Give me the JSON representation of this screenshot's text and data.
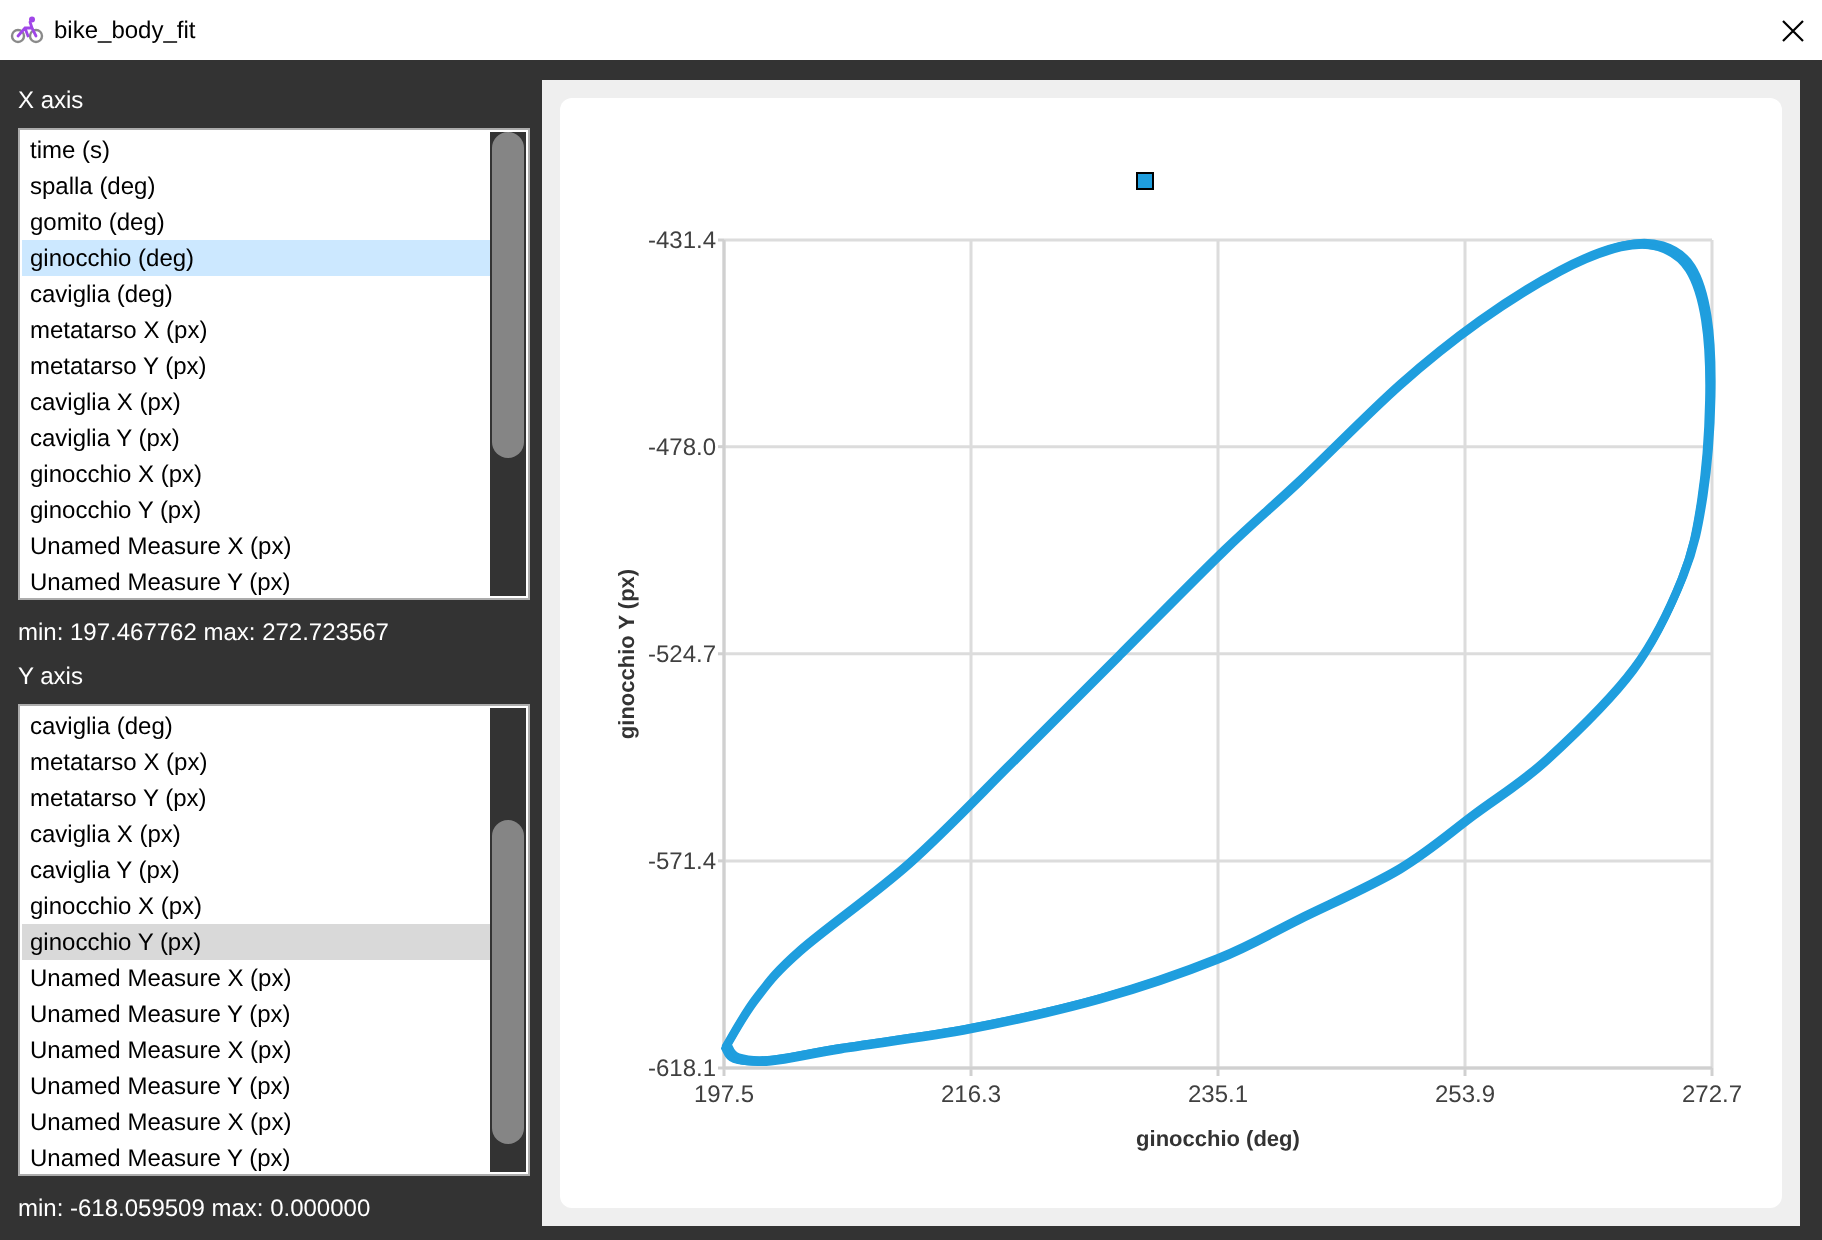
{
  "window": {
    "title": "bike_body_fit"
  },
  "x_axis_panel": {
    "label": "X axis",
    "focused": true,
    "items": [
      {
        "label": "time (s)",
        "selected": false
      },
      {
        "label": "spalla (deg)",
        "selected": false
      },
      {
        "label": "gomito (deg)",
        "selected": false
      },
      {
        "label": "ginocchio (deg)",
        "selected": true
      },
      {
        "label": "caviglia (deg)",
        "selected": false
      },
      {
        "label": "metatarso X (px)",
        "selected": false
      },
      {
        "label": "metatarso Y (px)",
        "selected": false
      },
      {
        "label": "caviglia X (px)",
        "selected": false
      },
      {
        "label": "caviglia Y (px)",
        "selected": false
      },
      {
        "label": "ginocchio X (px)",
        "selected": false
      },
      {
        "label": "ginocchio Y (px)",
        "selected": false
      },
      {
        "label": "Unamed Measure X (px)",
        "selected": false
      },
      {
        "label": "Unamed Measure Y (px)",
        "selected": false
      }
    ],
    "range": "min: 197.467762 max: 272.723567"
  },
  "y_axis_panel": {
    "label": "Y axis",
    "focused": false,
    "items": [
      {
        "label": "caviglia (deg)",
        "selected": false
      },
      {
        "label": "metatarso X (px)",
        "selected": false
      },
      {
        "label": "metatarso Y (px)",
        "selected": false
      },
      {
        "label": "caviglia X (px)",
        "selected": false
      },
      {
        "label": "caviglia Y (px)",
        "selected": false
      },
      {
        "label": "ginocchio X (px)",
        "selected": false
      },
      {
        "label": "ginocchio Y (px)",
        "selected": true
      },
      {
        "label": "Unamed Measure X (px)",
        "selected": false
      },
      {
        "label": "Unamed Measure Y (px)",
        "selected": false
      },
      {
        "label": "Unamed Measure X (px)",
        "selected": false
      },
      {
        "label": "Unamed Measure Y (px)",
        "selected": false
      },
      {
        "label": "Unamed Measure X (px)",
        "selected": false
      },
      {
        "label": "Unamed Measure Y (px)",
        "selected": false
      }
    ],
    "range": "min: -618.059509 max: 0.000000"
  },
  "chart": {
    "chart_data": {
      "type": "line",
      "xlabel": "ginocchio (deg)",
      "ylabel": "ginocchio Y (px)",
      "xlim": [
        197.5,
        272.7
      ],
      "ylim": [
        -618.1,
        -431.4
      ],
      "xticks": [
        197.5,
        216.3,
        235.1,
        253.9,
        272.7
      ],
      "yticks": [
        -431.4,
        {
          "value": -478,
          "label": "-478.0"
        },
        -524.7,
        -571.4,
        -618.1
      ],
      "grid": true
    }
  }
}
